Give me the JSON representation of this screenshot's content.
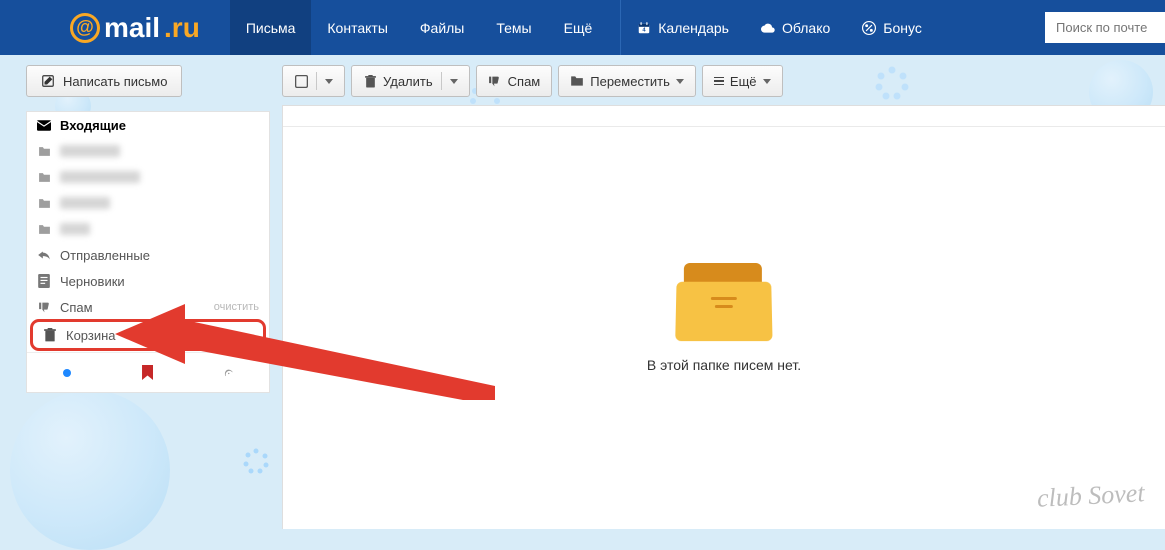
{
  "logo": {
    "mail": "mail",
    "ru": ".ru"
  },
  "nav": {
    "tabs": [
      "Письма",
      "Контакты",
      "Файлы",
      "Темы",
      "Ещё"
    ],
    "calendar": "Календарь",
    "cloud": "Облако",
    "bonus": "Бонус",
    "calendar_day": "4"
  },
  "search": {
    "placeholder": "Поиск по почте"
  },
  "compose": {
    "label": "Написать письмо"
  },
  "folders": {
    "inbox": "Входящие",
    "sent": "Отправленные",
    "drafts": "Черновики",
    "spam": "Спам",
    "spam_clear": "очистить",
    "trash": "Корзина"
  },
  "toolbar": {
    "delete": "Удалить",
    "spam": "Спам",
    "move": "Переместить",
    "more": "Ещё"
  },
  "empty": {
    "text": "В этой папке писем нет."
  },
  "watermark": "club Sovet"
}
